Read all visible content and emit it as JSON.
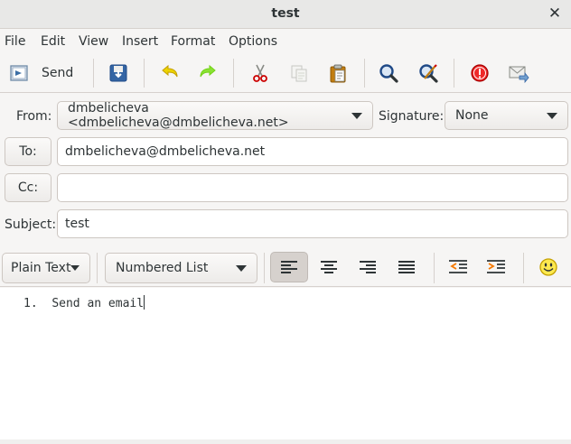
{
  "window": {
    "title": "test"
  },
  "menu": [
    "File",
    "Edit",
    "View",
    "Insert",
    "Format",
    "Options"
  ],
  "toolbar": {
    "send_label": "Send"
  },
  "headers": {
    "from_label": "From:",
    "from_value": "dmbelicheva <dmbelicheva@dmbelicheva.net>",
    "signature_label": "Signature:",
    "signature_value": "None",
    "to_label": "To:",
    "to_value": "dmbelicheva@dmbelicheva.net",
    "cc_label": "Cc:",
    "cc_value": "",
    "subject_label": "Subject:",
    "subject_value": "test"
  },
  "format": {
    "mode": "Plain Text",
    "paragraph_style": "Numbered List",
    "alignment_selected": "left"
  },
  "editor": {
    "list_marker": "1.",
    "list_item": "Send an email"
  },
  "colors": {
    "titlebar": "#e8e8e7",
    "undo_redo": "#c4a000",
    "redo": "#73d216",
    "stop": "#cc0000",
    "search": "#204a87"
  }
}
